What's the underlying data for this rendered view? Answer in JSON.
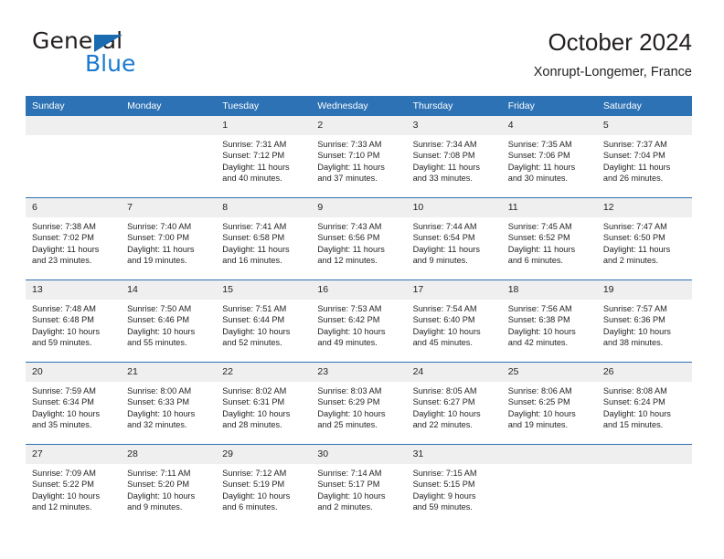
{
  "brand": {
    "name_part1": "General",
    "name_part2": "Blue"
  },
  "header": {
    "title": "October 2024",
    "location": "Xonrupt-Longemer, France"
  },
  "colors": {
    "header_blue": "#2c72b5",
    "logo_blue": "#1a7ad0",
    "daynum_band": "#efefef",
    "text": "#231f20"
  },
  "weekdays": [
    "Sunday",
    "Monday",
    "Tuesday",
    "Wednesday",
    "Thursday",
    "Friday",
    "Saturday"
  ],
  "labels": {
    "sunrise_prefix": "Sunrise:",
    "sunset_prefix": "Sunset:",
    "daylight_prefix": "Daylight:"
  },
  "weeks": [
    [
      {
        "day": "",
        "blank": true
      },
      {
        "day": "",
        "blank": true
      },
      {
        "day": "1",
        "sunrise": "Sunrise: 7:31 AM",
        "sunset": "Sunset: 7:12 PM",
        "daylight1": "Daylight: 11 hours",
        "daylight2": "and 40 minutes."
      },
      {
        "day": "2",
        "sunrise": "Sunrise: 7:33 AM",
        "sunset": "Sunset: 7:10 PM",
        "daylight1": "Daylight: 11 hours",
        "daylight2": "and 37 minutes."
      },
      {
        "day": "3",
        "sunrise": "Sunrise: 7:34 AM",
        "sunset": "Sunset: 7:08 PM",
        "daylight1": "Daylight: 11 hours",
        "daylight2": "and 33 minutes."
      },
      {
        "day": "4",
        "sunrise": "Sunrise: 7:35 AM",
        "sunset": "Sunset: 7:06 PM",
        "daylight1": "Daylight: 11 hours",
        "daylight2": "and 30 minutes."
      },
      {
        "day": "5",
        "sunrise": "Sunrise: 7:37 AM",
        "sunset": "Sunset: 7:04 PM",
        "daylight1": "Daylight: 11 hours",
        "daylight2": "and 26 minutes."
      }
    ],
    [
      {
        "day": "6",
        "sunrise": "Sunrise: 7:38 AM",
        "sunset": "Sunset: 7:02 PM",
        "daylight1": "Daylight: 11 hours",
        "daylight2": "and 23 minutes."
      },
      {
        "day": "7",
        "sunrise": "Sunrise: 7:40 AM",
        "sunset": "Sunset: 7:00 PM",
        "daylight1": "Daylight: 11 hours",
        "daylight2": "and 19 minutes."
      },
      {
        "day": "8",
        "sunrise": "Sunrise: 7:41 AM",
        "sunset": "Sunset: 6:58 PM",
        "daylight1": "Daylight: 11 hours",
        "daylight2": "and 16 minutes."
      },
      {
        "day": "9",
        "sunrise": "Sunrise: 7:43 AM",
        "sunset": "Sunset: 6:56 PM",
        "daylight1": "Daylight: 11 hours",
        "daylight2": "and 12 minutes."
      },
      {
        "day": "10",
        "sunrise": "Sunrise: 7:44 AM",
        "sunset": "Sunset: 6:54 PM",
        "daylight1": "Daylight: 11 hours",
        "daylight2": "and 9 minutes."
      },
      {
        "day": "11",
        "sunrise": "Sunrise: 7:45 AM",
        "sunset": "Sunset: 6:52 PM",
        "daylight1": "Daylight: 11 hours",
        "daylight2": "and 6 minutes."
      },
      {
        "day": "12",
        "sunrise": "Sunrise: 7:47 AM",
        "sunset": "Sunset: 6:50 PM",
        "daylight1": "Daylight: 11 hours",
        "daylight2": "and 2 minutes."
      }
    ],
    [
      {
        "day": "13",
        "sunrise": "Sunrise: 7:48 AM",
        "sunset": "Sunset: 6:48 PM",
        "daylight1": "Daylight: 10 hours",
        "daylight2": "and 59 minutes."
      },
      {
        "day": "14",
        "sunrise": "Sunrise: 7:50 AM",
        "sunset": "Sunset: 6:46 PM",
        "daylight1": "Daylight: 10 hours",
        "daylight2": "and 55 minutes."
      },
      {
        "day": "15",
        "sunrise": "Sunrise: 7:51 AM",
        "sunset": "Sunset: 6:44 PM",
        "daylight1": "Daylight: 10 hours",
        "daylight2": "and 52 minutes."
      },
      {
        "day": "16",
        "sunrise": "Sunrise: 7:53 AM",
        "sunset": "Sunset: 6:42 PM",
        "daylight1": "Daylight: 10 hours",
        "daylight2": "and 49 minutes."
      },
      {
        "day": "17",
        "sunrise": "Sunrise: 7:54 AM",
        "sunset": "Sunset: 6:40 PM",
        "daylight1": "Daylight: 10 hours",
        "daylight2": "and 45 minutes."
      },
      {
        "day": "18",
        "sunrise": "Sunrise: 7:56 AM",
        "sunset": "Sunset: 6:38 PM",
        "daylight1": "Daylight: 10 hours",
        "daylight2": "and 42 minutes."
      },
      {
        "day": "19",
        "sunrise": "Sunrise: 7:57 AM",
        "sunset": "Sunset: 6:36 PM",
        "daylight1": "Daylight: 10 hours",
        "daylight2": "and 38 minutes."
      }
    ],
    [
      {
        "day": "20",
        "sunrise": "Sunrise: 7:59 AM",
        "sunset": "Sunset: 6:34 PM",
        "daylight1": "Daylight: 10 hours",
        "daylight2": "and 35 minutes."
      },
      {
        "day": "21",
        "sunrise": "Sunrise: 8:00 AM",
        "sunset": "Sunset: 6:33 PM",
        "daylight1": "Daylight: 10 hours",
        "daylight2": "and 32 minutes."
      },
      {
        "day": "22",
        "sunrise": "Sunrise: 8:02 AM",
        "sunset": "Sunset: 6:31 PM",
        "daylight1": "Daylight: 10 hours",
        "daylight2": "and 28 minutes."
      },
      {
        "day": "23",
        "sunrise": "Sunrise: 8:03 AM",
        "sunset": "Sunset: 6:29 PM",
        "daylight1": "Daylight: 10 hours",
        "daylight2": "and 25 minutes."
      },
      {
        "day": "24",
        "sunrise": "Sunrise: 8:05 AM",
        "sunset": "Sunset: 6:27 PM",
        "daylight1": "Daylight: 10 hours",
        "daylight2": "and 22 minutes."
      },
      {
        "day": "25",
        "sunrise": "Sunrise: 8:06 AM",
        "sunset": "Sunset: 6:25 PM",
        "daylight1": "Daylight: 10 hours",
        "daylight2": "and 19 minutes."
      },
      {
        "day": "26",
        "sunrise": "Sunrise: 8:08 AM",
        "sunset": "Sunset: 6:24 PM",
        "daylight1": "Daylight: 10 hours",
        "daylight2": "and 15 minutes."
      }
    ],
    [
      {
        "day": "27",
        "sunrise": "Sunrise: 7:09 AM",
        "sunset": "Sunset: 5:22 PM",
        "daylight1": "Daylight: 10 hours",
        "daylight2": "and 12 minutes."
      },
      {
        "day": "28",
        "sunrise": "Sunrise: 7:11 AM",
        "sunset": "Sunset: 5:20 PM",
        "daylight1": "Daylight: 10 hours",
        "daylight2": "and 9 minutes."
      },
      {
        "day": "29",
        "sunrise": "Sunrise: 7:12 AM",
        "sunset": "Sunset: 5:19 PM",
        "daylight1": "Daylight: 10 hours",
        "daylight2": "and 6 minutes."
      },
      {
        "day": "30",
        "sunrise": "Sunrise: 7:14 AM",
        "sunset": "Sunset: 5:17 PM",
        "daylight1": "Daylight: 10 hours",
        "daylight2": "and 2 minutes."
      },
      {
        "day": "31",
        "sunrise": "Sunrise: 7:15 AM",
        "sunset": "Sunset: 5:15 PM",
        "daylight1": "Daylight: 9 hours",
        "daylight2": "and 59 minutes."
      },
      {
        "day": "",
        "blank": true
      },
      {
        "day": "",
        "blank": true
      }
    ]
  ]
}
